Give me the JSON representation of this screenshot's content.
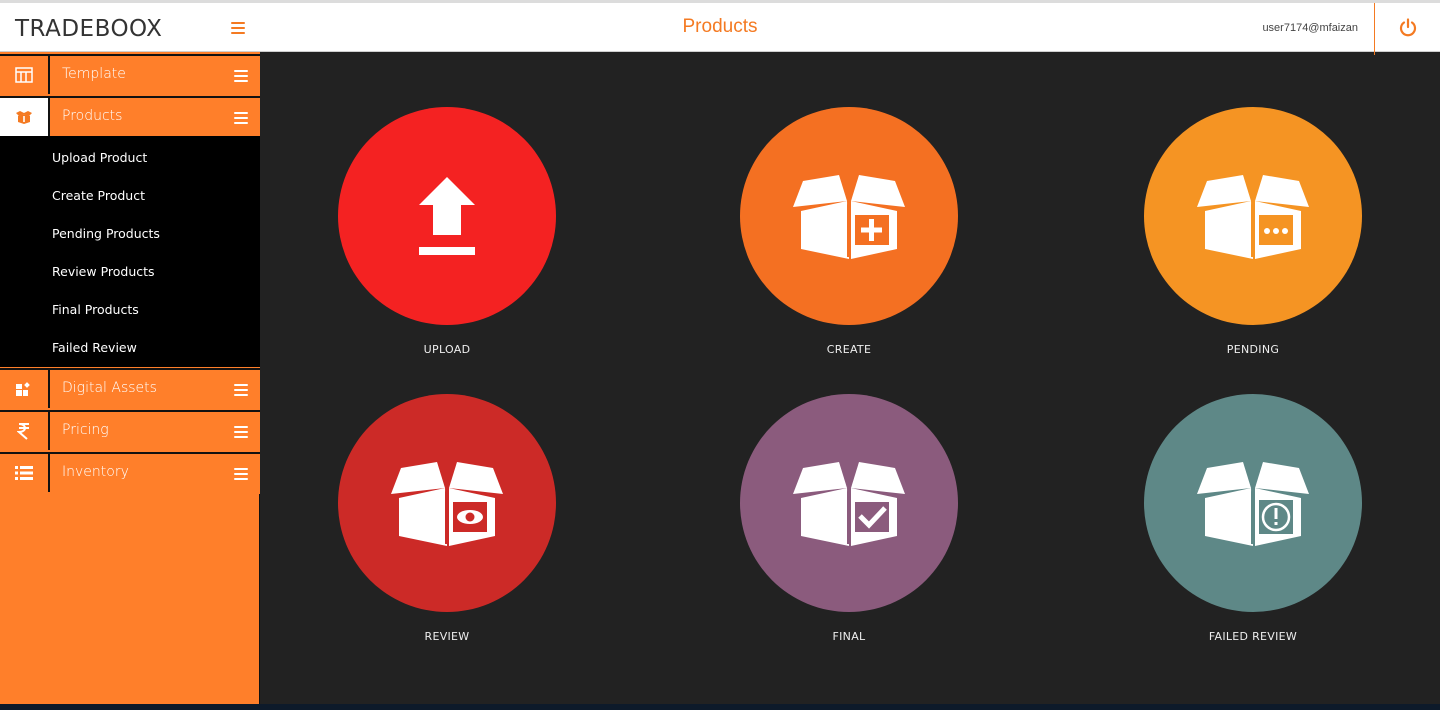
{
  "header": {
    "brand": "TRADEBOOX",
    "title": "Products",
    "user": "user7174@mfaizan"
  },
  "sidebar": {
    "items": [
      {
        "label": "Template",
        "icon": "template-icon"
      },
      {
        "label": "Products",
        "icon": "products-icon"
      },
      {
        "label": "Digital Assets",
        "icon": "digital-assets-icon"
      },
      {
        "label": "Pricing",
        "icon": "rupee-icon"
      },
      {
        "label": "Inventory",
        "icon": "list-icon"
      }
    ],
    "products_submenu": [
      "Upload Product",
      "Create Product",
      "Pending Products",
      "Review Products",
      "Final Products",
      "Failed Review"
    ]
  },
  "tiles": [
    {
      "caption": "UPLOAD",
      "color": "#f42222",
      "icon": "upload-icon"
    },
    {
      "caption": "CREATE",
      "color": "#f47022",
      "icon": "box-plus-icon"
    },
    {
      "caption": "PENDING",
      "color": "#f59423",
      "icon": "box-pending-icon"
    },
    {
      "caption": "REVIEW",
      "color": "#cc2a27",
      "icon": "box-eye-icon"
    },
    {
      "caption": "FINAL",
      "color": "#8b5b7d",
      "icon": "box-check-icon"
    },
    {
      "caption": "FAILED REVIEW",
      "color": "#5e8887",
      "icon": "box-alert-icon"
    }
  ],
  "colors": {
    "accent": "#f47a22",
    "sidebar": "#ff7f2a",
    "content_bg": "#222222"
  }
}
